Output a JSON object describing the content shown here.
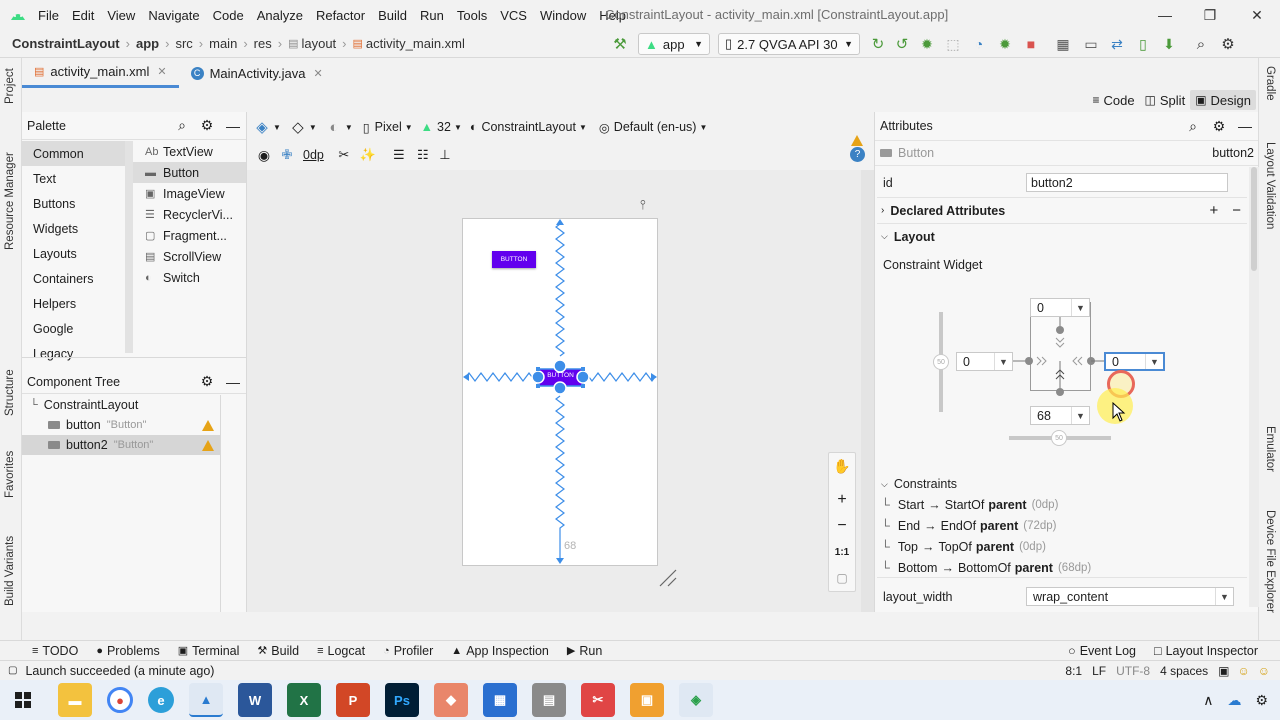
{
  "menu": {
    "items": [
      "File",
      "Edit",
      "View",
      "Navigate",
      "Code",
      "Analyze",
      "Refactor",
      "Build",
      "Run",
      "Tools",
      "VCS",
      "Window",
      "Help"
    ],
    "title": "ConstraintLayout - activity_main.xml [ConstraintLayout.app]"
  },
  "nav": {
    "crumbs": [
      "ConstraintLayout",
      "app",
      "src",
      "main",
      "res",
      "layout",
      "activity_main.xml"
    ],
    "run_config": "app",
    "device": "2.7  QVGA API 30"
  },
  "tabs": [
    {
      "label": "activity_main.xml",
      "active": true
    },
    {
      "label": "MainActivity.java",
      "active": false
    }
  ],
  "modes": [
    "Code",
    "Split",
    "Design"
  ],
  "left_strip": [
    "Project",
    "Resource Manager",
    "Structure",
    "Favorites",
    "Build Variants"
  ],
  "right_strip": [
    "Gradle",
    "Layout Validation",
    "Emulator",
    "Device File Explorer"
  ],
  "palette": {
    "title": "Palette",
    "categories": [
      "Common",
      "Text",
      "Buttons",
      "Widgets",
      "Layouts",
      "Containers",
      "Helpers",
      "Google",
      "Legacy"
    ],
    "selected_category": "Common",
    "items": [
      {
        "label": "TextView",
        "icon": "Ab"
      },
      {
        "label": "Button",
        "icon": "button-icon"
      },
      {
        "label": "ImageView",
        "icon": "image-icon"
      },
      {
        "label": "RecyclerVi...",
        "icon": "list-icon"
      },
      {
        "label": "Fragment...",
        "icon": "fragment-icon"
      },
      {
        "label": "ScrollView",
        "icon": "scroll-icon"
      },
      {
        "label": "Switch",
        "icon": "switch-icon"
      }
    ]
  },
  "component_tree": {
    "title": "Component Tree",
    "root": "ConstraintLayout",
    "children": [
      {
        "id": "button",
        "text": "\"Button\""
      },
      {
        "id": "button2",
        "text": "\"Button\""
      }
    ]
  },
  "canvas_toolbar": {
    "device": "Pixel",
    "api": "32",
    "theme": "ConstraintLayout",
    "locale": "Default (en-us)",
    "margin": "0dp"
  },
  "canvas": {
    "button1_text": "BUTTON",
    "button2_text": "BUTTON",
    "bottom_margin_label": "68",
    "zoom_fit_label": "1:1"
  },
  "attributes": {
    "title": "Attributes",
    "widget_type": "Button",
    "widget_id": "button2",
    "id_label": "id",
    "id_value": "button2",
    "declared_section": "Declared Attributes",
    "layout_section": "Layout",
    "constraint_widget_label": "Constraint Widget",
    "top_margin": "0",
    "start_margin": "0",
    "end_margin": "0",
    "bottom_margin": "68",
    "bias_vertical": "50",
    "bias_horizontal": "50",
    "constraints_label": "Constraints",
    "constraints": [
      {
        "side": "Start",
        "target": "StartOf",
        "parent": "parent",
        "dp": "(0dp)"
      },
      {
        "side": "End",
        "target": "EndOf",
        "parent": "parent",
        "dp": "(72dp)"
      },
      {
        "side": "Top",
        "target": "TopOf",
        "parent": "parent",
        "dp": "(0dp)"
      },
      {
        "side": "Bottom",
        "target": "BottomOf",
        "parent": "parent",
        "dp": "(68dp)"
      }
    ],
    "layout_width_label": "layout_width",
    "layout_width_value": "wrap_content"
  },
  "bottom_tools": [
    "TODO",
    "Problems",
    "Terminal",
    "Build",
    "Logcat",
    "Profiler",
    "App Inspection",
    "Run"
  ],
  "bottom_right_tools": [
    "Event Log",
    "Layout Inspector"
  ],
  "status": {
    "message": "Launch succeeded (a minute ago)",
    "position": "8:1",
    "line_sep": "LF",
    "encoding": "UTF-8",
    "indent": "4 spaces"
  },
  "colors": {
    "button_purple": "#6200ee",
    "constraint_blue": "#3d8ee8",
    "warning": "#e6a317"
  }
}
